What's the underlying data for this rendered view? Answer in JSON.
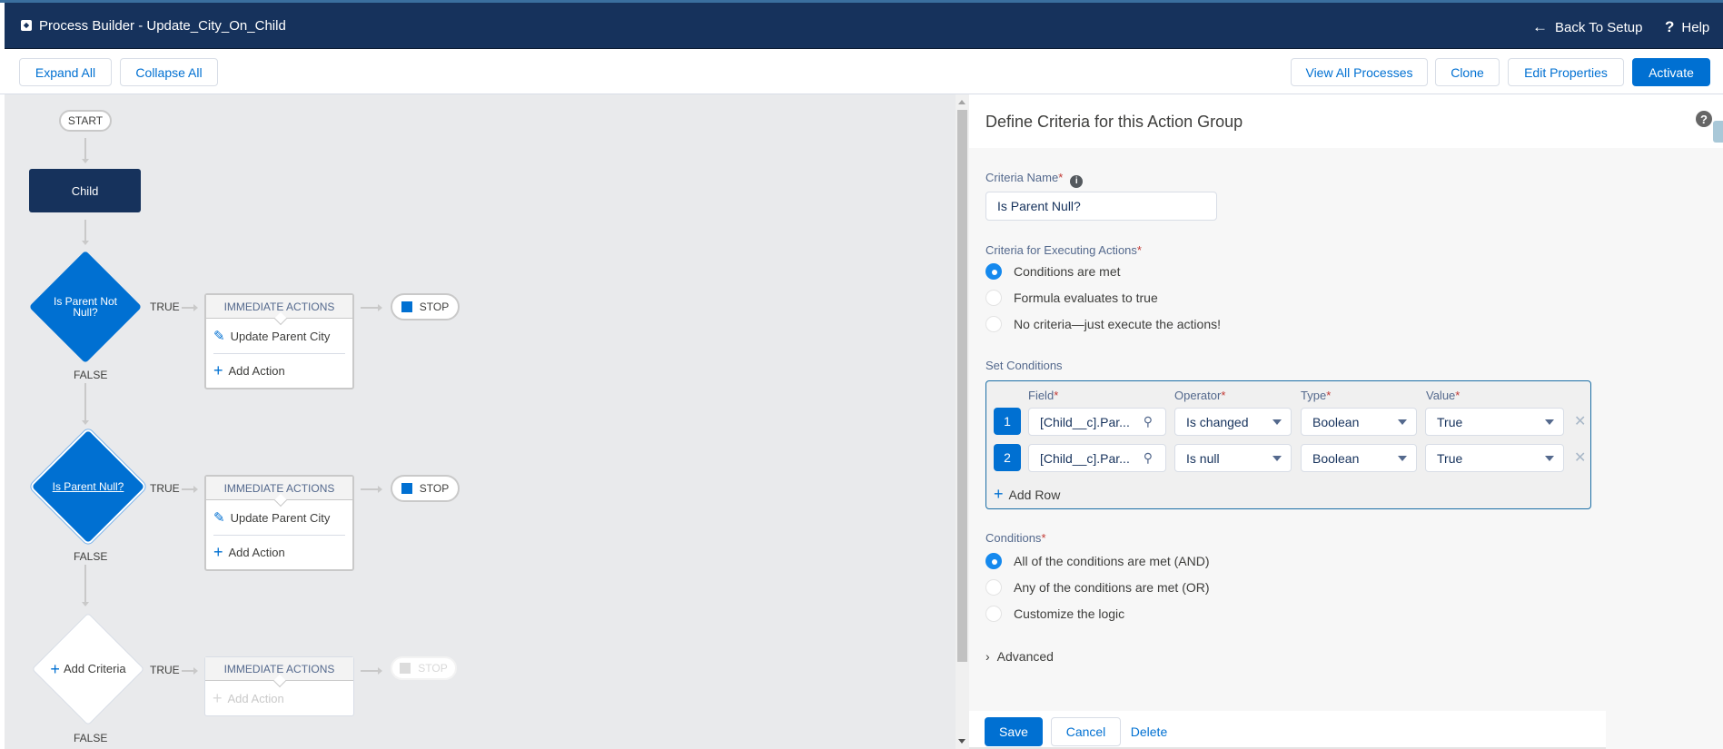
{
  "header": {
    "title": "Process Builder - Update_City_On_Child",
    "back_label": "Back To Setup",
    "help_label": "Help"
  },
  "toolbar": {
    "expand_all": "Expand All",
    "collapse_all": "Collapse All",
    "view_all_processes": "View All Processes",
    "clone": "Clone",
    "edit_properties": "Edit Properties",
    "activate": "Activate"
  },
  "flow": {
    "start_label": "START",
    "object_label": "Child",
    "true_label": "TRUE",
    "false_label": "FALSE",
    "stop_label": "STOP",
    "immediate_actions_label": "IMMEDIATE ACTIONS",
    "add_action_label": "Add Action",
    "nodes": [
      {
        "criteria": "Is Parent Not Null?",
        "action": "Update Parent City"
      },
      {
        "criteria": "Is Parent Null?",
        "action": "Update Parent City",
        "selected": true
      },
      {
        "criteria": "Add Criteria"
      }
    ]
  },
  "panel": {
    "title": "Define Criteria for this Action Group",
    "criteria_name_label": "Criteria Name",
    "criteria_name_value": "Is Parent Null?",
    "executing_label": "Criteria for Executing Actions",
    "executing_options": [
      {
        "label": "Conditions are met",
        "selected": true
      },
      {
        "label": "Formula evaluates to true",
        "selected": false
      },
      {
        "label": "No criteria—just execute the actions!",
        "selected": false
      }
    ],
    "set_conditions_label": "Set Conditions",
    "columns": {
      "field": "Field",
      "operator": "Operator",
      "type": "Type",
      "value": "Value"
    },
    "rows": [
      {
        "num": "1",
        "field": "[Child__c].Par...",
        "operator": "Is changed",
        "type": "Boolean",
        "value": "True"
      },
      {
        "num": "2",
        "field": "[Child__c].Par...",
        "operator": "Is null",
        "type": "Boolean",
        "value": "True"
      }
    ],
    "add_row_label": "Add Row",
    "conditions_label": "Conditions",
    "conditions_options": [
      {
        "label": "All of the conditions are met (AND)",
        "selected": true
      },
      {
        "label": "Any of the conditions are met (OR)",
        "selected": false
      },
      {
        "label": "Customize the logic",
        "selected": false
      }
    ],
    "advanced_label": "Advanced",
    "save": "Save",
    "cancel": "Cancel",
    "delete": "Delete"
  }
}
